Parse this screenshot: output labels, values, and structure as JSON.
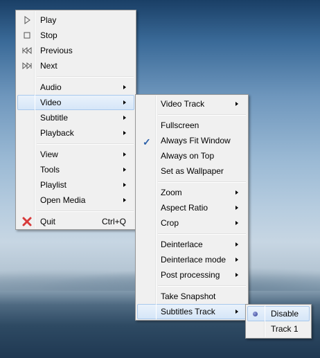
{
  "main_menu": {
    "items": [
      {
        "label": "Play",
        "icon": "play-icon"
      },
      {
        "label": "Stop",
        "icon": "stop-icon"
      },
      {
        "label": "Previous",
        "icon": "previous-icon"
      },
      {
        "label": "Next",
        "icon": "next-icon"
      },
      {
        "label": "Audio"
      },
      {
        "label": "Video"
      },
      {
        "label": "Subtitle"
      },
      {
        "label": "Playback"
      },
      {
        "label": "View"
      },
      {
        "label": "Tools"
      },
      {
        "label": "Playlist"
      },
      {
        "label": "Open Media"
      },
      {
        "label": "Quit",
        "shortcut": "Ctrl+Q",
        "icon": "quit-icon"
      }
    ]
  },
  "video_menu": {
    "items": [
      {
        "label": "Video Track"
      },
      {
        "label": "Fullscreen"
      },
      {
        "label": "Always Fit Window",
        "checked": true
      },
      {
        "label": "Always on Top"
      },
      {
        "label": "Set as Wallpaper"
      },
      {
        "label": "Zoom"
      },
      {
        "label": "Aspect Ratio"
      },
      {
        "label": "Crop"
      },
      {
        "label": "Deinterlace"
      },
      {
        "label": "Deinterlace mode"
      },
      {
        "label": "Post processing"
      },
      {
        "label": "Take Snapshot"
      },
      {
        "label": "Subtitles Track"
      }
    ]
  },
  "subtitles_track_menu": {
    "items": [
      {
        "label": "Disable",
        "selected": true
      },
      {
        "label": "Track 1"
      }
    ]
  },
  "colors": {
    "highlight_border": "#a8c8ec",
    "check": "#2b5fa8",
    "quit_icon": "#d83a3a",
    "menu_bg": "#f0f0f0"
  }
}
